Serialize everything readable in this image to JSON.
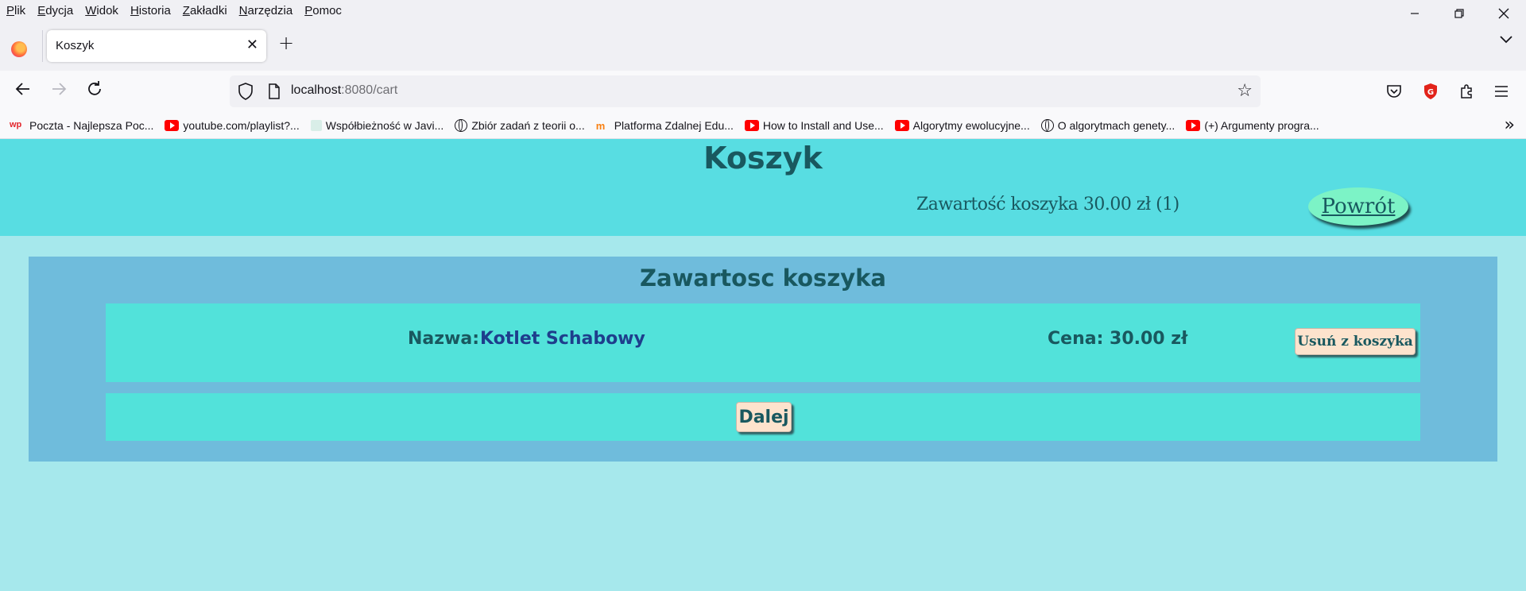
{
  "browser": {
    "menu": [
      "Plik",
      "Edycja",
      "Widok",
      "Historia",
      "Zakładki",
      "Narzędzia",
      "Pomoc"
    ],
    "tab_title": "Koszyk",
    "url_host": "localhost",
    "url_rest": ":8080/cart",
    "bookmarks": [
      {
        "label": "Poczta - Najlepsza Poc...",
        "icon": "wp-logo-icon"
      },
      {
        "label": "youtube.com/playlist?...",
        "icon": "youtube-icon"
      },
      {
        "label": "Współbieżność w Javi...",
        "icon": "java-site-icon"
      },
      {
        "label": "Zbiór zadań z teorii o...",
        "icon": "globe-icon"
      },
      {
        "label": "Platforma Zdalnej Edu...",
        "icon": "moodle-icon"
      },
      {
        "label": "How to Install and Use...",
        "icon": "youtube-icon"
      },
      {
        "label": "Algorytmy ewolucyjne...",
        "icon": "youtube-icon"
      },
      {
        "label": "O algorytmach genety...",
        "icon": "globe-icon"
      },
      {
        "label": "(+) Argumenty progra...",
        "icon": "youtube-icon"
      }
    ]
  },
  "header": {
    "title": "Koszyk",
    "cart_summary": "Zawartość koszyka 30.00 zł (1)",
    "back_label": "Powrót"
  },
  "cart": {
    "section_title": "Zawartosc koszyka",
    "items": [
      {
        "name_label": "Nazwa:",
        "name": "Kotlet Schabowy",
        "price": "Cena: 30.00 zł",
        "remove_label": "Usuń z koszyka"
      }
    ],
    "next_label": "Dalej"
  }
}
